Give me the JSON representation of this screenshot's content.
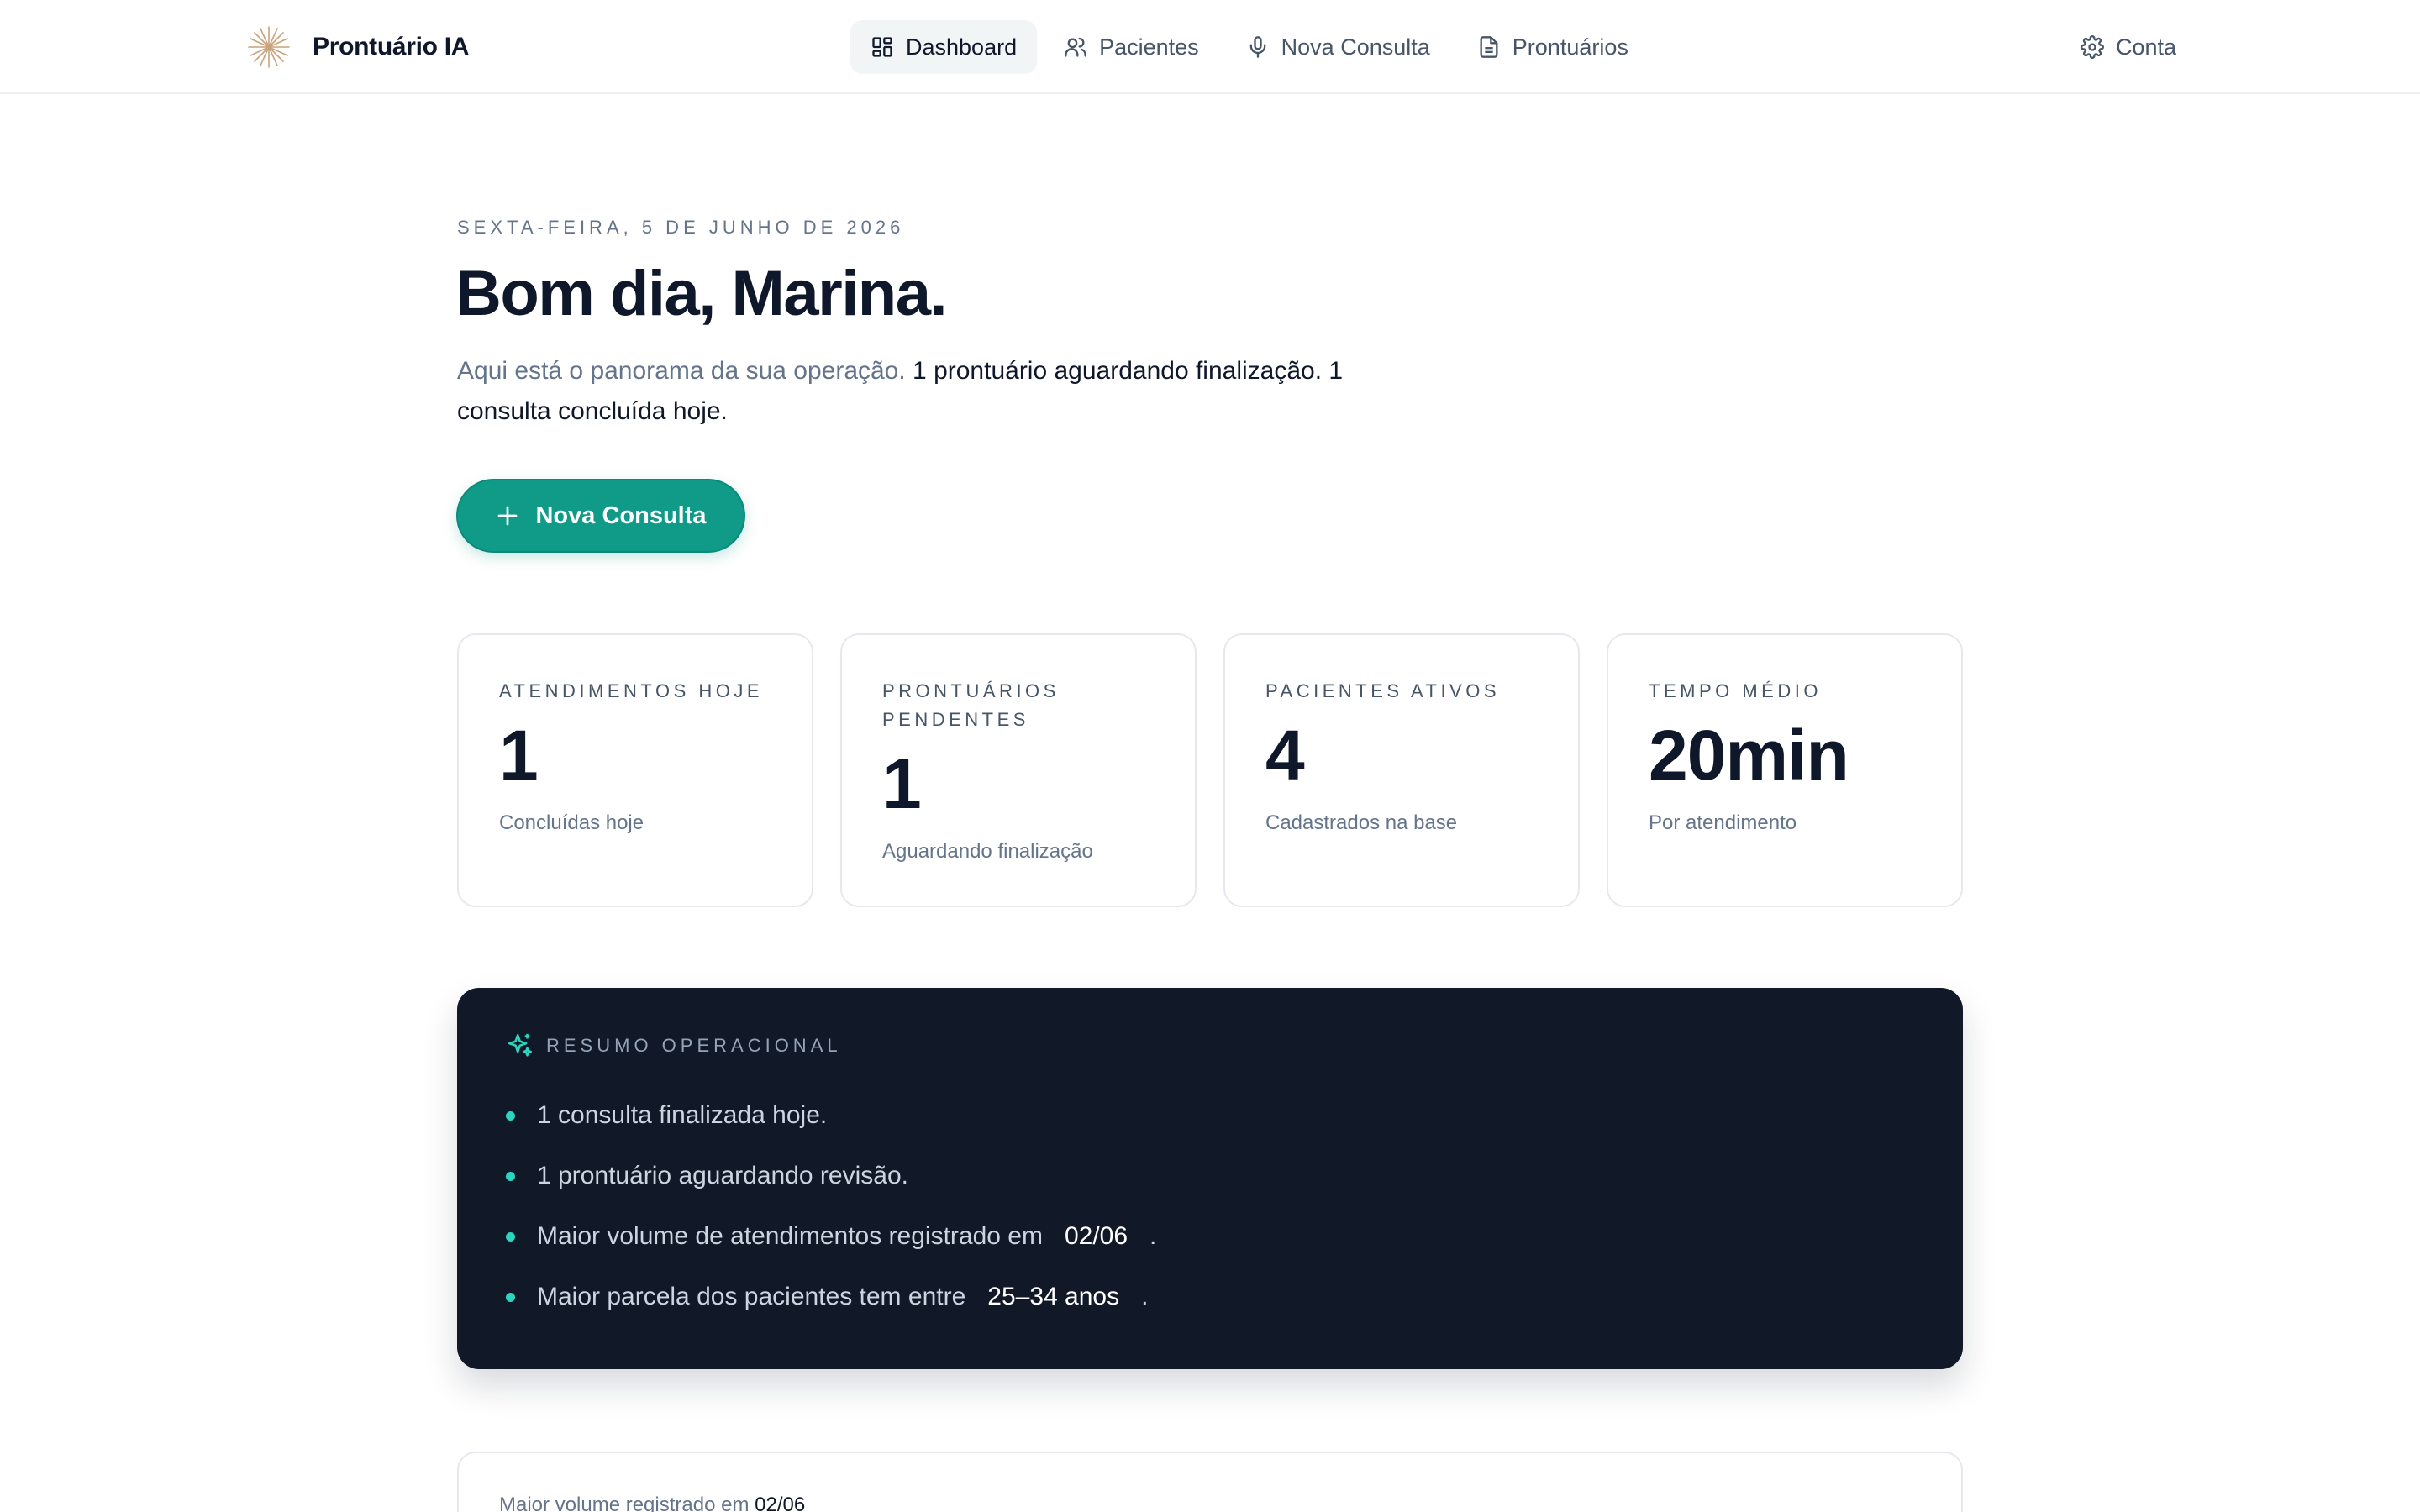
{
  "header": {
    "brand": "Prontuário IA",
    "nav": [
      {
        "label": "Dashboard",
        "icon": "dashboard-icon",
        "active": true
      },
      {
        "label": "Pacientes",
        "icon": "users-icon",
        "active": false
      },
      {
        "label": "Nova Consulta",
        "icon": "microphone-icon",
        "active": false
      },
      {
        "label": "Prontuários",
        "icon": "document-icon",
        "active": false
      }
    ],
    "account": "Conta"
  },
  "hero": {
    "date": "SEXTA-FEIRA, 5 DE JUNHO DE 2026",
    "greeting": "Bom dia, Marina.",
    "overview_muted": "Aqui está o panorama da sua operação.",
    "overview_text": "1 prontuário aguardando finalização. 1 consulta concluída hoje.",
    "cta": "Nova Consulta"
  },
  "stats": [
    {
      "label": "ATENDIMENTOS HOJE",
      "value": "1",
      "sub": "Concluídas hoje"
    },
    {
      "label": "PRONTUÁRIOS PENDENTES",
      "value": "1",
      "sub": "Aguardando finalização"
    },
    {
      "label": "PACIENTES ATIVOS",
      "value": "4",
      "sub": "Cadastrados na base"
    },
    {
      "label": "TEMPO MÉDIO",
      "value": "20min",
      "sub": "Por atendimento"
    }
  ],
  "summary": {
    "title": "RESUMO OPERACIONAL",
    "items": [
      {
        "text": "1 consulta finalizada hoje."
      },
      {
        "text": "1 prontuário aguardando revisão."
      },
      {
        "text": "Maior volume de atendimentos registrado em",
        "highlight": "02/06",
        "suffix": "."
      },
      {
        "text": "Maior parcela dos pacientes tem entre",
        "highlight": "25–34 anos",
        "suffix": "."
      }
    ]
  },
  "bottom": {
    "text": "Maior volume registrado em",
    "highlight": "02/06"
  },
  "colors": {
    "accent": "#0f9b88",
    "summary_bg": "#111827",
    "bullet": "#2dd4bf"
  }
}
